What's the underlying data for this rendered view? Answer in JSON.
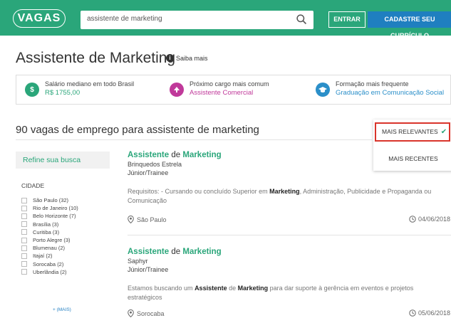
{
  "header": {
    "logo": "VAGAS",
    "search_value": "assistente de marketing",
    "entrar_label": "ENTRAR",
    "cadastre_label": "CADASTRE SEU CURRÍCULO",
    "colors": {
      "brand": "#2aa67a",
      "cta": "#1f7fc0"
    }
  },
  "title": {
    "main": "Assistente de Marketing",
    "saiba_mais": "Saiba mais"
  },
  "info": {
    "salario": {
      "icon": "dollar-icon",
      "label": "Salário mediano em todo Brasil",
      "value": "R$ 1755,00",
      "color": "#2aa67a"
    },
    "cargo": {
      "icon": "arrow-up-icon",
      "label": "Próximo cargo mais comum",
      "value": "Assistente Comercial",
      "color": "#c0399a"
    },
    "formacao": {
      "icon": "graduation-cap-icon",
      "label": "Formação mais frequente",
      "value": "Graduação em Comunicação Social",
      "color": "#2b8fc9"
    }
  },
  "results": {
    "title": "90 vagas de emprego para assistente de marketing"
  },
  "sort": {
    "relevantes": "MAIS RELEVANTES",
    "recentes": "MAIS RECENTES",
    "highlight_color": "#d9342b"
  },
  "sidebar": {
    "refine": "Refine sua busca",
    "cidade_header": "CIDADE",
    "cities": [
      "São Paulo (32)",
      "Rio de Janeiro (10)",
      "Belo Horizonte (7)",
      "Brasília (3)",
      "Curitiba (3)",
      "Porto Alegre (3)",
      "Blumenau (2)",
      "Itajaí (2)",
      "Sorocaba (2)",
      "Uberlândia (2)"
    ],
    "mais": "+ (MAIS)"
  },
  "jobs": [
    {
      "title_a": "Assistente",
      "title_de": " de ",
      "title_b": "Marketing",
      "company": "Brinquedos Estrela",
      "level": "Júnior/Trainee",
      "desc_1": "Requisitos: - Cursando ou concluído Superior em ",
      "desc_kw1": "Marketing",
      "desc_2": ", Administração, Publicidade e Propaganda ou Comunicação",
      "location": "São Paulo",
      "date": "04/06/2018"
    },
    {
      "title_a": "Assistente",
      "title_de": " de ",
      "title_b": "Marketing",
      "company": "Saphyr",
      "level": "Júnior/Trainee",
      "desc_1": "Estamos buscando um ",
      "desc_kw1": "Assistente",
      "desc_mid": " de ",
      "desc_kw2": "Marketing",
      "desc_2": " para dar suporte à gerência em eventos e projetos estratégicos",
      "location": "Sorocaba",
      "date": "05/06/2018"
    }
  ]
}
